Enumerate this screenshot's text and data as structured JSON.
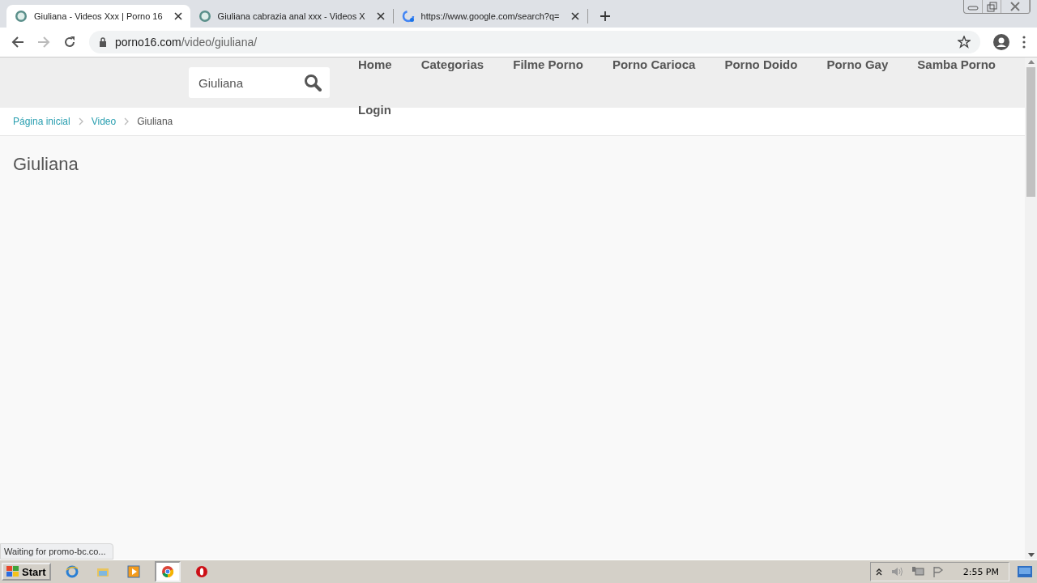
{
  "browser": {
    "tabs": [
      {
        "title": "Giuliana - Videos Xxx | Porno 16",
        "kind": "site",
        "selected": true
      },
      {
        "title": "Giuliana cabrazia anal xxx - Videos X",
        "kind": "site",
        "selected": false
      },
      {
        "title": "https://www.google.com/search?q=",
        "kind": "google",
        "selected": false
      }
    ],
    "url_host": "porno16.com",
    "url_path": "/video/giuliana/",
    "status": "Waiting for promo-bc.co..."
  },
  "page": {
    "search": {
      "value": "Giuliana"
    },
    "nav": [
      "Home",
      "Categorias",
      "Filme Porno",
      "Porno Carioca",
      "Porno Doido",
      "Porno Gay",
      "Samba Porno",
      "Login"
    ],
    "breadcrumb": [
      "Página inicial",
      "Video",
      "Giuliana"
    ],
    "heading": "Giuliana"
  },
  "taskbar": {
    "start": "Start",
    "clock": "2:55 PM",
    "apps": [
      {
        "kind": "ie",
        "selected": false
      },
      {
        "kind": "explorer",
        "selected": false
      },
      {
        "kind": "media",
        "selected": false
      },
      {
        "kind": "chrome",
        "selected": true
      },
      {
        "kind": "opera",
        "selected": false
      }
    ]
  }
}
